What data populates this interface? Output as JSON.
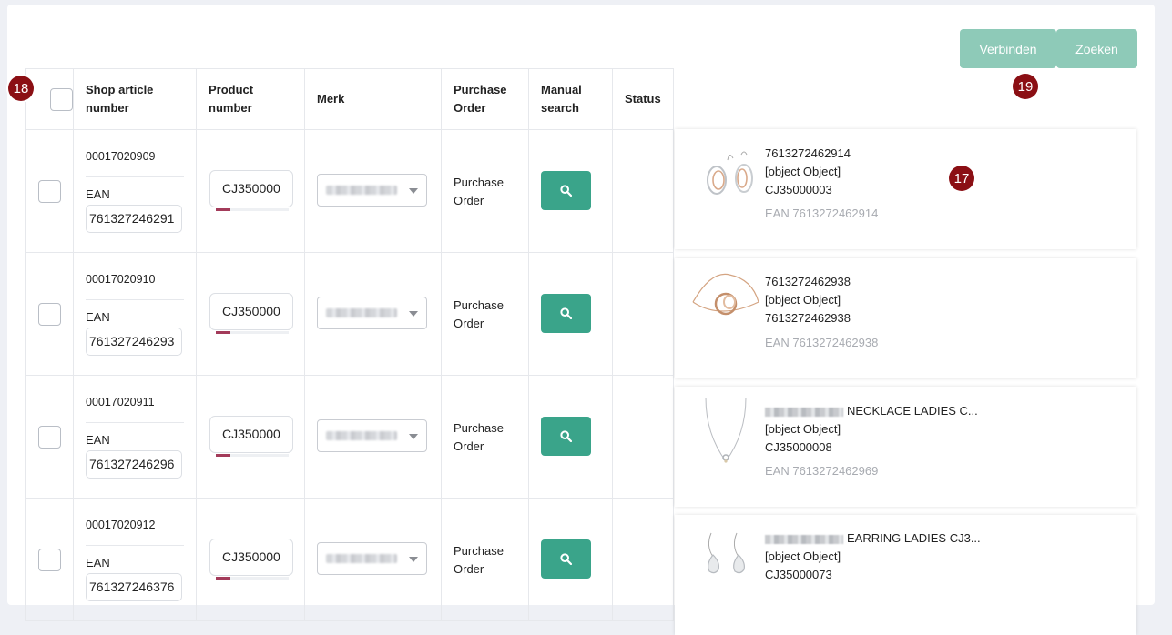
{
  "toolbar": {
    "connect_label": "Verbinden",
    "search_label": "Zoeken"
  },
  "annotations": {
    "table": "18",
    "buttons": "19",
    "results": "17"
  },
  "table": {
    "headers": {
      "shop_article_number_line1": "Shop article",
      "shop_article_number_line2": "number",
      "product_number_line1": "Product",
      "product_number_line2": "number",
      "brand": "Merk",
      "purchase_order_line1": "Purchase",
      "purchase_order_line2": "Order",
      "manual_search_line1": "Manual",
      "manual_search_line2": "search",
      "status": "Status"
    },
    "rows": [
      {
        "shop_article_number": "00017020909",
        "ean_label": "EAN",
        "ean_value": "761327246291",
        "product_number": "CJ350000",
        "po_line1": "Purchase",
        "po_line2": "Order",
        "status": ""
      },
      {
        "shop_article_number": "00017020910",
        "ean_label": "EAN",
        "ean_value": "761327246293",
        "product_number": "CJ350000",
        "po_line1": "Purchase",
        "po_line2": "Order",
        "status": ""
      },
      {
        "shop_article_number": "00017020911",
        "ean_label": "EAN",
        "ean_value": "761327246296",
        "product_number": "CJ350000",
        "po_line1": "Purchase",
        "po_line2": "Order",
        "status": ""
      },
      {
        "shop_article_number": "00017020912",
        "ean_label": "EAN",
        "ean_value": "761327246376",
        "product_number": "CJ350000",
        "po_line1": "Purchase",
        "po_line2": "Order",
        "status": ""
      }
    ]
  },
  "results": [
    {
      "line1": "7613272462914",
      "line2": "[object Object]",
      "line3": "CJ35000003",
      "ean": "EAN 7613272462914",
      "image": "earrings-icon"
    },
    {
      "line1": "7613272462938",
      "line2": "[object Object]",
      "line3": "7613272462938",
      "ean": "EAN 7613272462938",
      "image": "bracelet-icon"
    },
    {
      "line1": "NECKLACE LADIES C...",
      "line2": "[object Object]",
      "line3": "CJ35000008",
      "ean": "EAN 7613272462969",
      "image": "necklace-icon"
    },
    {
      "line1": "EARRING LADIES CJ3...",
      "line2": "[object Object]",
      "line3": "CJ35000073",
      "ean": "",
      "image": "drop-earrings-icon"
    }
  ],
  "colors": {
    "accent": "#3aa48a",
    "button_muted": "#8ecab8",
    "badge": "#8b0f14",
    "progress": "#a33b5a"
  }
}
